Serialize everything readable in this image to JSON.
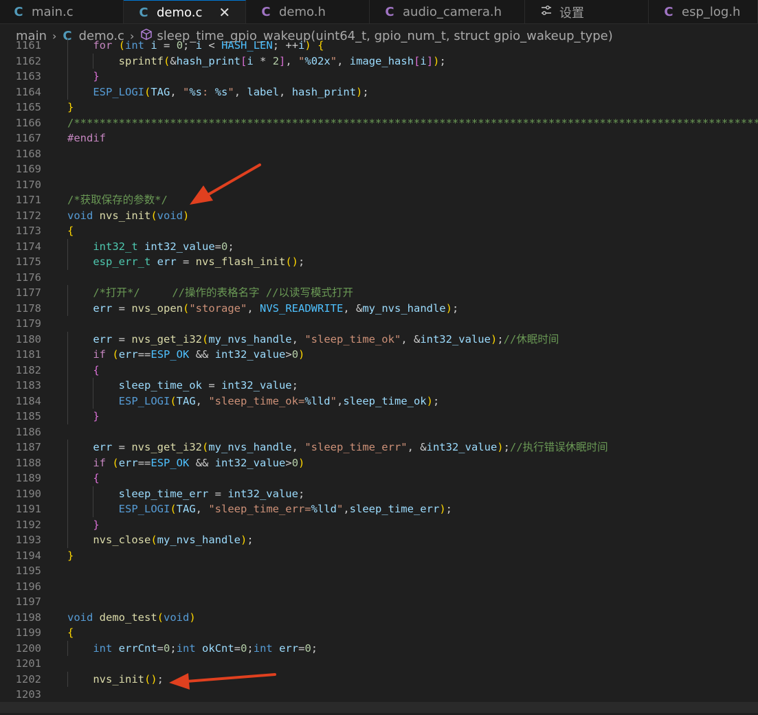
{
  "tabs": [
    {
      "label": "main.c",
      "icon": "c-file-icon",
      "color": "#519aba",
      "active": false
    },
    {
      "label": "demo.c",
      "icon": "c-file-icon",
      "color": "#519aba",
      "active": true
    },
    {
      "label": "demo.h",
      "icon": "c-file-icon",
      "color": "#a074c4",
      "active": false
    },
    {
      "label": "audio_camera.h",
      "icon": "c-file-icon",
      "color": "#a074c4",
      "active": false
    },
    {
      "label": "设置",
      "icon": "settings-icon",
      "active": false
    },
    {
      "label": "esp_log.h",
      "icon": "c-file-icon",
      "color": "#a074c4",
      "active": false
    }
  ],
  "tab_icon_glyph": "C",
  "close_glyph": "✕",
  "breadcrumb": {
    "folder": "main",
    "file": "demo.c",
    "symbol": "sleep_time_gpio_wakeup(uint64_t, gpio_num_t, struct gpio_wakeup_type)",
    "separator": "›"
  },
  "editor": {
    "lines": [
      {
        "n": "1161",
        "code": "    for (int i = 0; i < HASH_LEN; ++i) {"
      },
      {
        "n": "1162",
        "code": "        sprintf(&hash_print[i * 2], \"%02x\", image_hash[i]);"
      },
      {
        "n": "1163",
        "code": "    }"
      },
      {
        "n": "1164",
        "code": "    ESP_LOGI(TAG, \"%s: %s\", label, hash_print);"
      },
      {
        "n": "1165",
        "code": "}"
      },
      {
        "n": "1166",
        "code": "/*****************************************************************************************************************"
      },
      {
        "n": "1167",
        "code": "#endif"
      },
      {
        "n": "1168",
        "code": ""
      },
      {
        "n": "1169",
        "code": ""
      },
      {
        "n": "1170",
        "code": ""
      },
      {
        "n": "1171",
        "code": "/*获取保存的参数*/"
      },
      {
        "n": "1172",
        "code": "void nvs_init(void)"
      },
      {
        "n": "1173",
        "code": "{"
      },
      {
        "n": "1174",
        "code": "    int32_t int32_value=0;"
      },
      {
        "n": "1175",
        "code": "    esp_err_t err = nvs_flash_init();"
      },
      {
        "n": "1176",
        "code": ""
      },
      {
        "n": "1177",
        "code": "    /*打开*/     //操作的表格名字 //以读写模式打开"
      },
      {
        "n": "1178",
        "code": "    err = nvs_open(\"storage\", NVS_READWRITE, &my_nvs_handle);"
      },
      {
        "n": "1179",
        "code": ""
      },
      {
        "n": "1180",
        "code": "    err = nvs_get_i32(my_nvs_handle, \"sleep_time_ok\", &int32_value);//休眠时间"
      },
      {
        "n": "1181",
        "code": "    if (err==ESP_OK && int32_value>0)"
      },
      {
        "n": "1182",
        "code": "    {"
      },
      {
        "n": "1183",
        "code": "        sleep_time_ok = int32_value;"
      },
      {
        "n": "1184",
        "code": "        ESP_LOGI(TAG, \"sleep_time_ok=%lld\",sleep_time_ok);"
      },
      {
        "n": "1185",
        "code": "    }"
      },
      {
        "n": "1186",
        "code": ""
      },
      {
        "n": "1187",
        "code": "    err = nvs_get_i32(my_nvs_handle, \"sleep_time_err\", &int32_value);//执行错误休眠时间"
      },
      {
        "n": "1188",
        "code": "    if (err==ESP_OK && int32_value>0)"
      },
      {
        "n": "1189",
        "code": "    {"
      },
      {
        "n": "1190",
        "code": "        sleep_time_err = int32_value;"
      },
      {
        "n": "1191",
        "code": "        ESP_LOGI(TAG, \"sleep_time_err=%lld\",sleep_time_err);"
      },
      {
        "n": "1192",
        "code": "    }"
      },
      {
        "n": "1193",
        "code": "    nvs_close(my_nvs_handle);"
      },
      {
        "n": "1194",
        "code": "}"
      },
      {
        "n": "1195",
        "code": ""
      },
      {
        "n": "1196",
        "code": ""
      },
      {
        "n": "1197",
        "code": ""
      },
      {
        "n": "1198",
        "code": "void demo_test(void)"
      },
      {
        "n": "1199",
        "code": "{"
      },
      {
        "n": "1200",
        "code": "    int errCnt=0;int okCnt=0;int err=0;"
      },
      {
        "n": "1201",
        "code": ""
      },
      {
        "n": "1202",
        "code": "    nvs_init();"
      },
      {
        "n": "1203",
        "code": ""
      }
    ]
  },
  "colors": {
    "annotation_arrow": "#e0401f",
    "background": "#1f1f1f"
  }
}
